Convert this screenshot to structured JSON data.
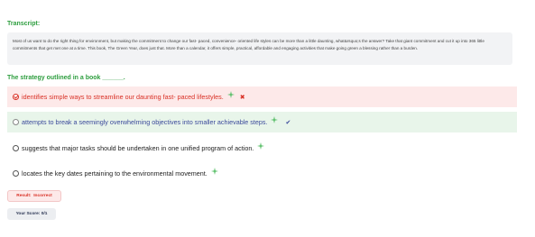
{
  "transcript": {
    "label": "Transcript:",
    "text": "Most of us want to do the right thing for environment, but making the commitment to change our fast- paced, convenience- oriented life styles can be more than a little daunting, what&rsquo;s the answer? Take that giant commitment and cut it up into 365 little commitments that get met one at a time. This book, The Green Year, does just that. More than a calendar, it offers simple, practical, affordable and engaging activities that make going green a blessing rather than a burden."
  },
  "question": "The strategy outlined in a book ______.",
  "options": [
    {
      "text": "identifies simple ways to streamline our daunting fast- paced lifestyles.",
      "state": "selected-wrong"
    },
    {
      "text": "attempts to break a seemingly overwhelming objectives into smaller achievable steps.",
      "state": "correct"
    },
    {
      "text": "suggests that major tasks should be undertaken in one unified program of action.",
      "state": "none"
    },
    {
      "text": "locates the key dates pertaining to the environmental movement.",
      "state": "none"
    }
  ],
  "result": {
    "label": "Result:",
    "value": "Incorrect"
  },
  "score": {
    "label": "Your Score:",
    "value": "0/1"
  },
  "colors": {
    "green": "#2e9e3f",
    "red": "#d93025",
    "blue": "#3b4a9b",
    "wrong_bg": "#fde9e9",
    "right_bg": "#e8f5ea"
  },
  "icons": {
    "hint": "sparkle-icon",
    "wrong": "cross-icon",
    "correct": "check-icon"
  }
}
